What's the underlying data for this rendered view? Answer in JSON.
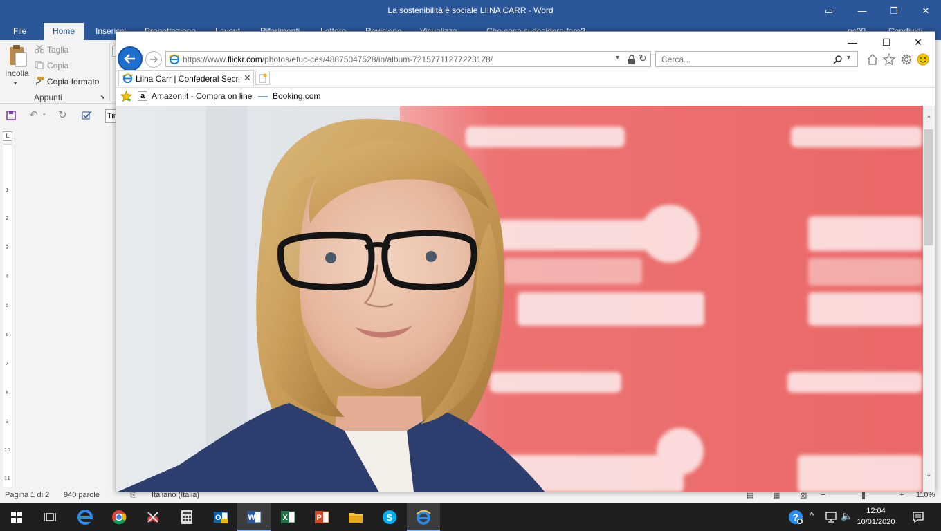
{
  "word": {
    "title": "La sostenibilità è sociale LIINA CARR - Word",
    "tabs": [
      {
        "label": "File"
      },
      {
        "label": "Home"
      },
      {
        "label": "Inserisci"
      },
      {
        "label": "Progettazione"
      },
      {
        "label": "Layout"
      },
      {
        "label": "Riferimenti"
      },
      {
        "label": "Lettere"
      },
      {
        "label": "Revisione"
      },
      {
        "label": "Visualizza"
      }
    ],
    "tell_me": "Che cosa si desidera fare?",
    "user": "pc00",
    "share": "Condividi",
    "clipboard": {
      "paste": "Incolla",
      "cut": "Taglia",
      "copy": "Copia",
      "format_painter": "Copia formato",
      "group": "Appunti"
    },
    "font_box": "Tin",
    "ruler_numbers": [
      "1",
      "2",
      "3",
      "4",
      "5",
      "6",
      "7",
      "8",
      "9",
      "10",
      "11"
    ],
    "ruler_corner": "L",
    "status": {
      "page": "Pagina 1 di 2",
      "words": "940 parole",
      "language": "Italiano (Italia)",
      "zoom": "110%"
    }
  },
  "ie": {
    "url_prefix": "https://www.",
    "url_domain": "flickr.com",
    "url_path": "/photos/etuc-ces/48875047528/in/album-72157711277223128/",
    "search_placeholder": "Cerca...",
    "tab_title": "Liina Carr | Confederal Secr...",
    "favorites": [
      {
        "label": "Amazon.it - Compra on line"
      },
      {
        "label": "Booking.com"
      }
    ],
    "colors": {
      "back_button": "#1e6fd0",
      "banner_red": "#e8595a"
    }
  },
  "taskbar": {
    "time": "12:04",
    "date": "10/01/2020"
  }
}
